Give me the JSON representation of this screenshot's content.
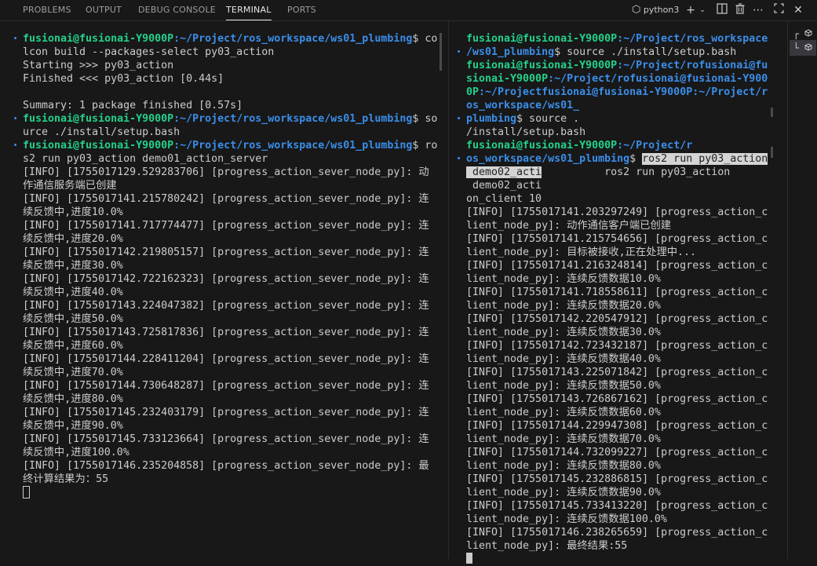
{
  "panel_tabs": [
    "PROBLEMS",
    "OUTPUT",
    "DEBUG CONSOLE",
    "TERMINAL",
    "PORTS"
  ],
  "active_tab": "TERMINAL",
  "terminal_profile": "python3",
  "icons": {
    "profile": "terminal-profile-icon",
    "add": "plus-icon",
    "dropdown": "chevron-down-icon",
    "split": "split-terminal-icon",
    "kill": "trash-icon",
    "more": "ellipsis-icon",
    "maximize": "maximize-icon",
    "close": "close-icon"
  },
  "terminal_list": {
    "items": [
      "terminal-icon-1",
      "terminal-icon-2"
    ],
    "item1_label": "┌",
    "item2_label": "└"
  },
  "left_terminal": {
    "lines": [
      {
        "user": "fusionai@fusionai-Y9000P",
        "path": ":~/Project/ros_workspace/ws01_plumbing",
        "rest": "$ co"
      },
      {
        "text": "lcon build --packages-select py03_action"
      },
      {
        "text": "Starting >>> py03_action"
      },
      {
        "text": "Finished <<< py03_action [0.44s]"
      },
      {
        "text": ""
      },
      {
        "text": "Summary: 1 package finished [0.57s]"
      },
      {
        "user": "fusionai@fusionai-Y9000P",
        "path": ":~/Project/ros_workspace/ws01_plumbing",
        "rest": "$ so"
      },
      {
        "text": "urce ./install/setup.bash"
      },
      {
        "user": "fusionai@fusionai-Y9000P",
        "path": ":~/Project/ros_workspace/ws01_plumbing",
        "rest": "$ ro"
      },
      {
        "text": "s2 run py03_action demo01_action_server"
      },
      {
        "text": "[INFO] [1755017129.529283706] [progress_action_sever_node_py]: 动"
      },
      {
        "text": "作通信服务端已创建"
      },
      {
        "text": "[INFO] [1755017141.215780242] [progress_action_sever_node_py]: 连"
      },
      {
        "text": "续反馈中,进度10.0%"
      },
      {
        "text": "[INFO] [1755017141.717774477] [progress_action_sever_node_py]: 连"
      },
      {
        "text": "续反馈中,进度20.0%"
      },
      {
        "text": "[INFO] [1755017142.219805157] [progress_action_sever_node_py]: 连"
      },
      {
        "text": "续反馈中,进度30.0%"
      },
      {
        "text": "[INFO] [1755017142.722162323] [progress_action_sever_node_py]: 连"
      },
      {
        "text": "续反馈中,进度40.0%"
      },
      {
        "text": "[INFO] [1755017143.224047382] [progress_action_sever_node_py]: 连"
      },
      {
        "text": "续反馈中,进度50.0%"
      },
      {
        "text": "[INFO] [1755017143.725817836] [progress_action_sever_node_py]: 连"
      },
      {
        "text": "续反馈中,进度60.0%"
      },
      {
        "text": "[INFO] [1755017144.228411204] [progress_action_sever_node_py]: 连"
      },
      {
        "text": "续反馈中,进度70.0%"
      },
      {
        "text": "[INFO] [1755017144.730648287] [progress_action_sever_node_py]: 连"
      },
      {
        "text": "续反馈中,进度80.0%"
      },
      {
        "text": "[INFO] [1755017145.232403179] [progress_action_sever_node_py]: 连"
      },
      {
        "text": "续反馈中,进度90.0%"
      },
      {
        "text": "[INFO] [1755017145.733123664] [progress_action_sever_node_py]: 连"
      },
      {
        "text": "续反馈中,进度100.0%"
      },
      {
        "text": "[INFO] [1755017146.235204858] [progress_action_sever_node_py]: 最"
      },
      {
        "text": "终计算结果为：55"
      },
      {
        "cursor": "box"
      }
    ]
  },
  "right_terminal": {
    "lines": [
      {
        "user": "fusionai@fusionai-Y9000P",
        "path": ":~/Project/ros_workspace"
      },
      {
        "path": "/ws01_plumbing",
        "rest": "$ source ./install/setup.bash"
      },
      {
        "user": "fusionai@fusionai-Y9000P",
        "path": ":~/Project/rofusionai@fu"
      },
      {
        "user": "sionai-Y9000P",
        "path": ":~/Project/rofusionai@fusionai-Y900"
      },
      {
        "user": "0P",
        "path": ":~/Projectfusionai@fusionai-Y9000P:~/Project/r"
      },
      {
        "path": "os_workspace/ws01_"
      },
      {
        "path": "plumbing",
        "rest": "$ source ."
      },
      {
        "text": "/install/setup.bash"
      },
      {
        "user": "fusionai@fusionai-Y9000P",
        "path": ":~/Project/r"
      },
      {
        "path": "os_workspace/ws01_plumbing",
        "rest": "$ ",
        "sel": "ros2 run py03_action"
      },
      {
        "sel": " demo02_acti",
        "rest": "          ros2 run py03_action"
      },
      {
        "text": " demo02_acti"
      },
      {
        "text": "on_client 10"
      },
      {
        "text": "[INFO] [1755017141.203297249] [progress_action_c"
      },
      {
        "text": "lient_node_py]: 动作通信客户端已创建"
      },
      {
        "text": "[INFO] [1755017141.215754656] [progress_action_c"
      },
      {
        "text": "lient_node_py]: 目标被接收,正在处理中..."
      },
      {
        "text": "[INFO] [1755017141.216324814] [progress_action_c"
      },
      {
        "text": "lient_node_py]: 连续反馈数据10.0%"
      },
      {
        "text": "[INFO] [1755017141.718558611] [progress_action_c"
      },
      {
        "text": "lient_node_py]: 连续反馈数据20.0%"
      },
      {
        "text": "[INFO] [1755017142.220547912] [progress_action_c"
      },
      {
        "text": "lient_node_py]: 连续反馈数据30.0%"
      },
      {
        "text": "[INFO] [1755017142.723432187] [progress_action_c"
      },
      {
        "text": "lient_node_py]: 连续反馈数据40.0%"
      },
      {
        "text": "[INFO] [1755017143.225071842] [progress_action_c"
      },
      {
        "text": "lient_node_py]: 连续反馈数据50.0%"
      },
      {
        "text": "[INFO] [1755017143.726867162] [progress_action_c"
      },
      {
        "text": "lient_node_py]: 连续反馈数据60.0%"
      },
      {
        "text": "[INFO] [1755017144.229947308] [progress_action_c"
      },
      {
        "text": "lient_node_py]: 连续反馈数据70.0%"
      },
      {
        "text": "[INFO] [1755017144.732099227] [progress_action_c"
      },
      {
        "text": "lient_node_py]: 连续反馈数据80.0%"
      },
      {
        "text": "[INFO] [1755017145.232886815] [progress_action_c"
      },
      {
        "text": "lient_node_py]: 连续反馈数据90.0%"
      },
      {
        "text": "[INFO] [1755017145.733413220] [progress_action_c"
      },
      {
        "text": "lient_node_py]: 连续反馈数据100.0%"
      },
      {
        "text": "[INFO] [1755017146.238265659] [progress_action_c"
      },
      {
        "text": "lient_node_py]: 最终结果:55"
      },
      {
        "cursor": "fill"
      }
    ]
  },
  "colors": {
    "background": "#181818",
    "prompt_user": "#23d18b",
    "prompt_path": "#3b8eea",
    "text": "#cccccc"
  }
}
